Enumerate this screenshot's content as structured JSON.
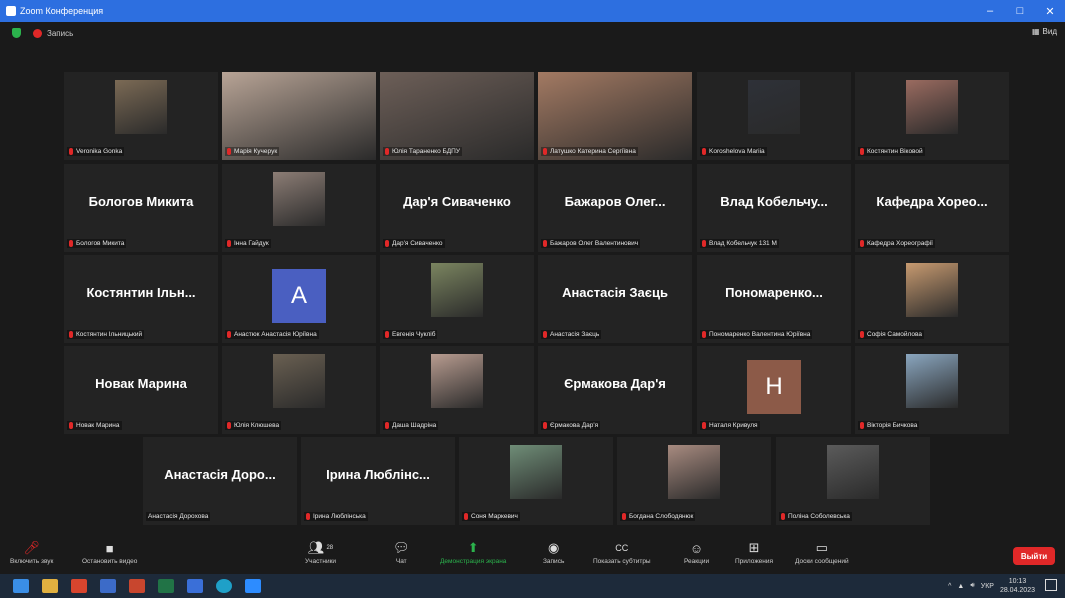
{
  "window": {
    "title": "Zoom Конференция",
    "controls": [
      "–",
      "□",
      "✕"
    ]
  },
  "topbar": {
    "recording_label": "Запись",
    "view_label": "Вид"
  },
  "rows": [
    [
      {
        "label": "Veronika Gonka",
        "photo": "#7b6a55"
      },
      {
        "label": "Марія Кучерук",
        "photo": "#b8a496",
        "wide": true
      },
      {
        "label": "Юлія Тараненко БДПУ",
        "photo": "#6d5f58",
        "wide": true
      },
      {
        "label": "Латушко Катерина Сергіївна",
        "photo": "#a37a63",
        "wide": true,
        "active": true
      },
      {
        "label": "Koroshelova Mariia",
        "photo": "#2e3138"
      },
      {
        "label": "Костянтин Віковой",
        "photo": "#9a6b60"
      }
    ],
    [
      {
        "name": "Бологов Микита",
        "label": "Бологов Микита"
      },
      {
        "label": "Інна Гайдук",
        "photo": "#8c7d75"
      },
      {
        "name": "Дар'я Сиваченко",
        "label": "Дар'я Сиваченко"
      },
      {
        "name": "Бажаров Олег...",
        "label": "Бажаров Олег Валентинович"
      },
      {
        "name": "Влад Кобельчу...",
        "label": "Влад Кобельчук 131 М"
      },
      {
        "name": "Кафедра Хорео...",
        "label": "Кафедра Хореографії"
      }
    ],
    [
      {
        "name": "Костянтин Ільн...",
        "label": "Костянтин Ільницький"
      },
      {
        "initial": "A",
        "initial_color": "#4a5fc1",
        "label": "Анастюк Анастасія Юріївна"
      },
      {
        "label": "Евгенія Чукліб",
        "photo": "#7b8560"
      },
      {
        "name": "Анастасія Заєць",
        "label": "Анастасія Заєць"
      },
      {
        "name": "Пономаренко...",
        "label": "Пономаренко Валентина Юріївна"
      },
      {
        "label": "Софія Самойлова",
        "photo": "#c79a70"
      }
    ],
    [
      {
        "name": "Новак Марина",
        "label": "Новак Марина"
      },
      {
        "label": "Юлія Клюшева",
        "photo": "#6a6052"
      },
      {
        "label": "Даша Шадріна",
        "photo": "#b89c90"
      },
      {
        "name": "Єрмакова Дар'я",
        "label": "Єрмакова Дар'я"
      },
      {
        "initial": "H",
        "initial_color": "#8c5a48",
        "label": "Наталя Кривуля"
      },
      {
        "label": "Вікторія Бичкова",
        "photo": "#8aa6bf"
      }
    ],
    [
      {
        "name": "Анастасія Доро...",
        "label": "Анастасія Дорохова",
        "nomic": true
      },
      {
        "name": "Ірина Люблінс...",
        "label": "Ірина Люблінська"
      },
      {
        "label": "Соня Маркевич",
        "photo": "#6f8d77"
      },
      {
        "label": "Богдана Слободянюк",
        "photo": "#a88b80"
      },
      {
        "label": "Поліна Соболевська",
        "photo": "#5b5b5b"
      }
    ]
  ],
  "toolbar": {
    "unmute": "Включить звук",
    "stop_video": "Остановить видео",
    "participants": "Участники",
    "participants_count": "28",
    "chat": "Чат",
    "share_screen": "Демонстрация экрана",
    "record": "Запись",
    "captions": "Показать субтитры",
    "reactions": "Реакции",
    "apps": "Приложения",
    "whiteboards": "Доски сообщений",
    "leave": "Выйти"
  },
  "taskbar": {
    "lang": "УКР",
    "time": "10:13",
    "date": "28.04.2023"
  }
}
